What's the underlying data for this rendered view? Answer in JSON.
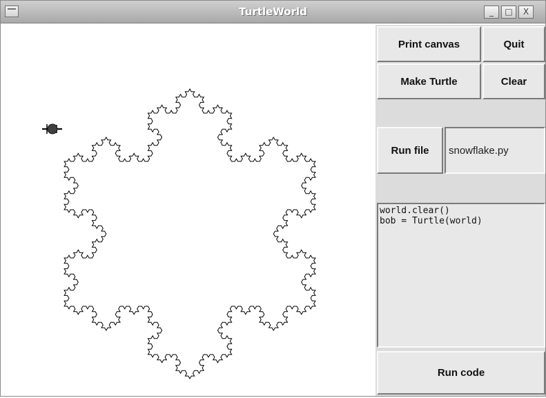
{
  "window": {
    "title": "TurtleWorld",
    "controls": {
      "minimize": "_",
      "maximize": "□",
      "close": "X"
    }
  },
  "toolbar": {
    "print_canvas": "Print canvas",
    "quit": "Quit",
    "make_turtle": "Make Turtle",
    "clear": "Clear",
    "run_file": "Run file",
    "run_code": "Run code"
  },
  "file_input": {
    "value": "snowflake.py"
  },
  "code_editor": {
    "value": "world.clear()\nbob = Turtle(world)"
  },
  "canvas": {
    "drawing": "koch-snowflake",
    "turtle_icon": "turtle-icon",
    "line_color": "#000000",
    "turtle_color": "#404040"
  }
}
